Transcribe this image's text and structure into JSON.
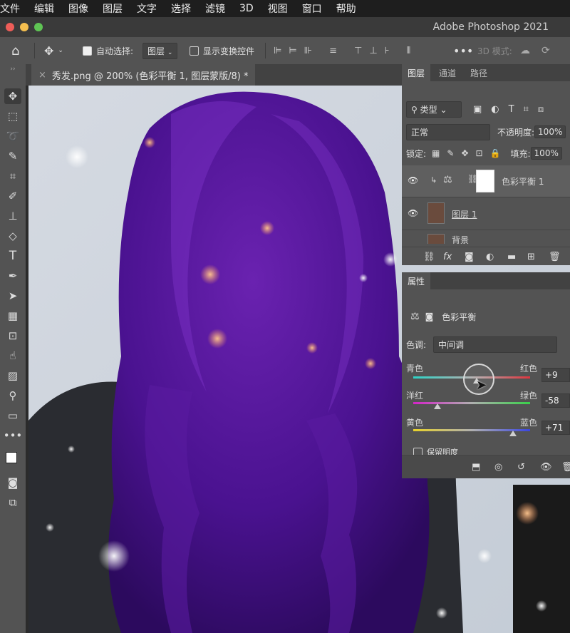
{
  "menubar": {
    "items": [
      "文件",
      "编辑",
      "图像",
      "图层",
      "文字",
      "选择",
      "滤镜",
      "3D",
      "视图",
      "窗口",
      "帮助"
    ]
  },
  "window": {
    "title": "Adobe Photoshop 2021"
  },
  "options": {
    "auto_select_label": "自动选择:",
    "auto_select_value": "图层",
    "show_transform_label": "显示变换控件",
    "mode_3d_label": "3D 模式:"
  },
  "document": {
    "tab_title": "秀发.png @ 200% (色彩平衡 1, 图层蒙版/8) *"
  },
  "layers_panel": {
    "tabs": [
      "图层",
      "通道",
      "路径"
    ],
    "filter_label": "类型",
    "blend_mode": "正常",
    "opacity_label": "不透明度:",
    "opacity_value": "100%",
    "lock_label": "锁定:",
    "fill_label": "填充:",
    "fill_value": "100%",
    "layers": [
      {
        "name": "色彩平衡 1"
      },
      {
        "name": "图层 1"
      },
      {
        "name": "背景"
      }
    ]
  },
  "properties_panel": {
    "tab": "属性",
    "adjustment_name": "色彩平衡",
    "tone_label": "色调:",
    "tone_value": "中间调",
    "sliders": [
      {
        "left": "青色",
        "right": "红色",
        "value": "+9",
        "level": 9
      },
      {
        "left": "洋红",
        "right": "绿色",
        "value": "-58",
        "level": -58
      },
      {
        "left": "黄色",
        "right": "蓝色",
        "value": "+71",
        "level": 71
      }
    ],
    "preserve_label": "保留明度"
  }
}
